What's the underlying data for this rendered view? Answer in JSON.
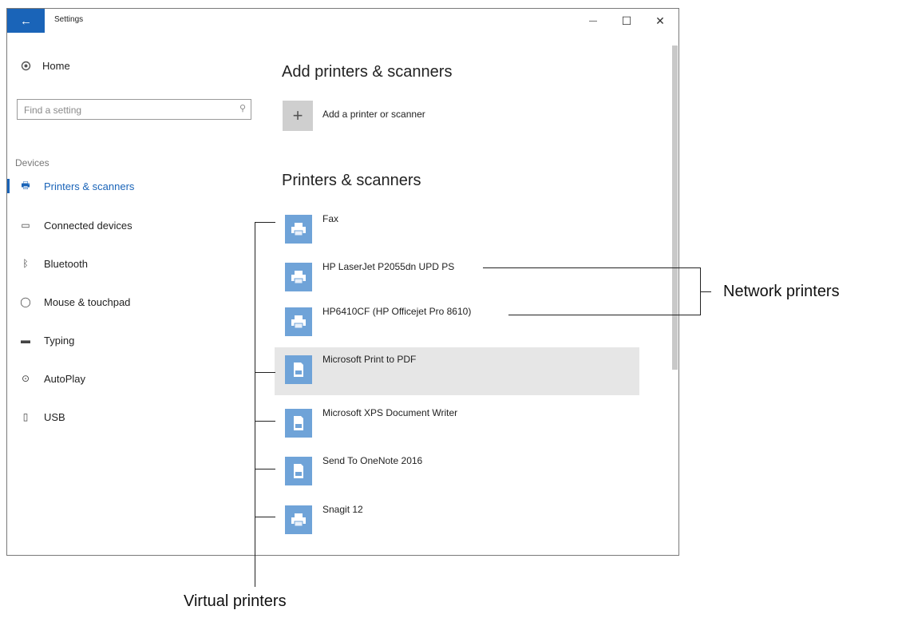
{
  "titlebar": {
    "back_glyph": "←",
    "title": "Settings",
    "minimize_glyph": "—",
    "maximize_glyph": "☐",
    "close_glyph": "✕"
  },
  "sidebar": {
    "home_label": "Home",
    "search_placeholder": "Find a setting",
    "section": "Devices",
    "items": [
      {
        "label": "Printers & scanners",
        "icon": "printer-icon",
        "active": true
      },
      {
        "label": "Connected devices",
        "icon": "connected-devices-icon",
        "active": false
      },
      {
        "label": "Bluetooth",
        "icon": "bluetooth-icon",
        "active": false
      },
      {
        "label": "Mouse & touchpad",
        "icon": "mouse-icon",
        "active": false
      },
      {
        "label": "Typing",
        "icon": "keyboard-icon",
        "active": false
      },
      {
        "label": "AutoPlay",
        "icon": "autoplay-icon",
        "active": false
      },
      {
        "label": "USB",
        "icon": "usb-icon",
        "active": false
      }
    ]
  },
  "main": {
    "add_heading": "Add printers & scanners",
    "add_label": "Add a printer or scanner",
    "list_heading": "Printers & scanners",
    "printers": [
      {
        "name": "Fax",
        "icon": "printer-icon"
      },
      {
        "name": "HP LaserJet P2055dn UPD PS",
        "icon": "printer-icon"
      },
      {
        "name": "HP6410CF (HP Officejet Pro 8610)",
        "icon": "printer-icon"
      },
      {
        "name": "Microsoft Print to PDF",
        "icon": "document-icon",
        "selected": true
      },
      {
        "name": "Microsoft XPS Document Writer",
        "icon": "document-icon"
      },
      {
        "name": "Send To OneNote 2016",
        "icon": "document-icon"
      },
      {
        "name": "Snagit 12",
        "icon": "printer-icon"
      }
    ]
  },
  "annotations": {
    "network": "Network printers",
    "virtual": "Virtual printers"
  },
  "colors": {
    "accent": "#1a64b8",
    "tile": "#6fa3d8",
    "selected_row": "#e6e6e6"
  }
}
